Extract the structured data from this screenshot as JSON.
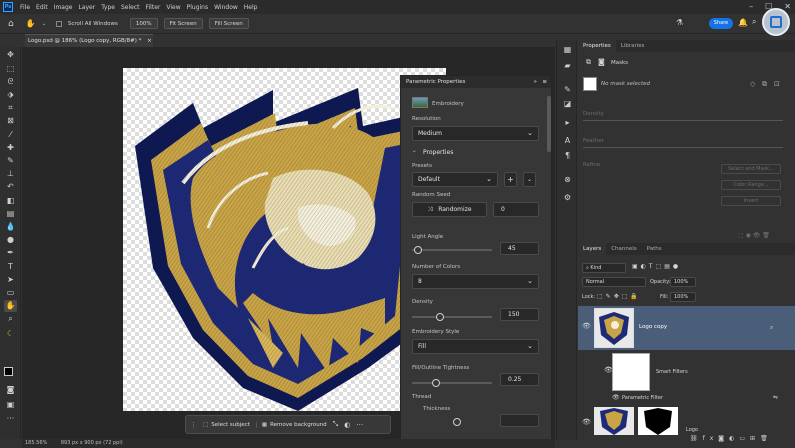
{
  "menubar": {
    "app_badge": "Ps",
    "items": [
      "File",
      "Edit",
      "Image",
      "Layer",
      "Type",
      "Select",
      "Filter",
      "View",
      "Plugins",
      "Window",
      "Help"
    ]
  },
  "options_bar": {
    "scroll_all_windows": "Scroll All Windows",
    "zoom_100": "100%",
    "fit_screen": "Fit Screen",
    "fill_screen": "Fill Screen",
    "share": "Share"
  },
  "document": {
    "tab_title": "Logo.psd @ 186% (Logo copy, RGB/8#) *",
    "close": "×"
  },
  "contextual_taskbar": {
    "select_subject": "Select subject",
    "remove_background": "Remove background",
    "more": "···"
  },
  "parametric_panel": {
    "title": "Parametric Properties",
    "filter_name": "Embroidery",
    "resolution_label": "Resolution",
    "resolution_value": "Medium",
    "properties_header": "Properties",
    "presets_label": "Presets",
    "presets_value": "Default",
    "random_seed_label": "Random Seed",
    "randomize_label": "Randomize",
    "seed_value": "0",
    "light_angle_label": "Light Angle",
    "light_angle_value": "45",
    "number_of_colors_label": "Number of Colors",
    "number_of_colors_value": "8",
    "density_label": "Density",
    "density_value": "150",
    "embroidery_style_label": "Embroidery Style",
    "embroidery_style_value": "Fill",
    "fill_outline_tightness_label": "Fill/Outline Tightness",
    "fill_outline_tightness_value": "0.25",
    "thread_label": "Thread",
    "thickness_label": "Thickness",
    "light_angle_fraction": 0.08,
    "density_fraction": 0.35,
    "tightness_fraction": 0.3
  },
  "properties_panel": {
    "tabs": [
      "Properties",
      "Libraries"
    ],
    "masks_label": "Masks",
    "no_mask": "No mask selected",
    "density": "Density",
    "feather": "Feather",
    "refine": "Refine",
    "select_and_mask": "Select and Mask...",
    "color_range": "Color Range...",
    "invert": "Invert"
  },
  "layers_panel": {
    "tabs": [
      "Layers",
      "Channels",
      "Paths"
    ],
    "kind": "Kind",
    "blend_mode": "Normal",
    "opacity_label": "Opacity:",
    "opacity_value": "100%",
    "lock_label": "Lock:",
    "fill_label": "Fill:",
    "fill_value": "100%",
    "layers": [
      {
        "name": "Logo copy"
      },
      {
        "name": "Smart Filters"
      },
      {
        "name": "Parametric Filter"
      },
      {
        "name": "Logo"
      }
    ],
    "footer_icons": [
      "link-icon",
      "fx-icon",
      "mask-icon",
      "adjustment-icon",
      "folder-icon",
      "new-layer-icon",
      "trash-icon"
    ]
  },
  "status_bar": {
    "zoom": "185.56%",
    "doc_size": "893 px x 900 px (72 ppi)"
  },
  "colors": {
    "accent": "#1473e6",
    "navy": "#1e2a78",
    "gold": "#c9a447",
    "cream": "#f1ead2"
  }
}
